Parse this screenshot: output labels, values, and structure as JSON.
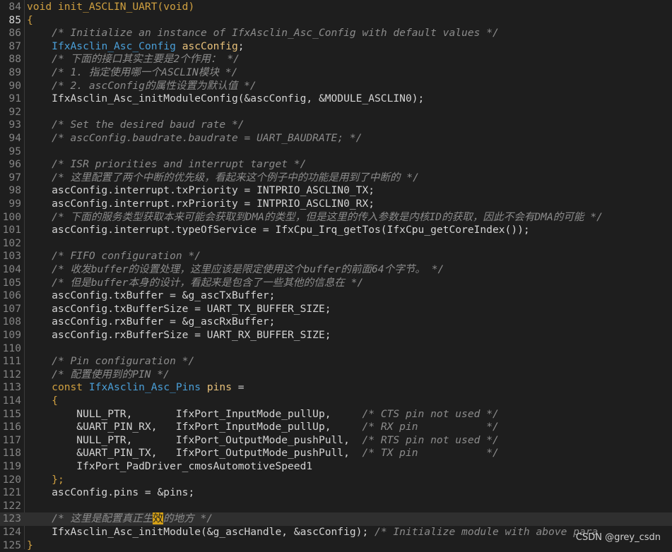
{
  "editor": {
    "lines": [
      {
        "n": "84",
        "segments": [
          {
            "t": "void init_ASCLIN_UART(void)",
            "c": "kw"
          }
        ]
      },
      {
        "n": "85",
        "current": true,
        "segments": [
          {
            "t": "{",
            "c": "kw"
          }
        ]
      },
      {
        "n": "86",
        "segments": [
          {
            "t": "    "
          },
          {
            "t": "/* Initialize an instance of IfxAsclin_Asc_Config with default values */",
            "c": "cm"
          }
        ]
      },
      {
        "n": "87",
        "segments": [
          {
            "t": "    "
          },
          {
            "t": "IfxAsclin_Asc_Config",
            "c": "ty"
          },
          {
            "t": " "
          },
          {
            "t": "ascConfig",
            "c": "vr"
          },
          {
            "t": ";"
          }
        ]
      },
      {
        "n": "88",
        "segments": [
          {
            "t": "    "
          },
          {
            "t": "/* 下面的接口其实主要是2个作用： */",
            "c": "cm"
          }
        ]
      },
      {
        "n": "89",
        "segments": [
          {
            "t": "    "
          },
          {
            "t": "/* 1. 指定使用哪一个ASCLIN模块 */",
            "c": "cm"
          }
        ]
      },
      {
        "n": "90",
        "segments": [
          {
            "t": "    "
          },
          {
            "t": "/* 2. ascConfig的属性设置为默认值 */",
            "c": "cm"
          }
        ]
      },
      {
        "n": "91",
        "segments": [
          {
            "t": "    IfxAsclin_Asc_initModuleConfig(&ascConfig, &MODULE_ASCLIN0);"
          }
        ]
      },
      {
        "n": "92",
        "segments": []
      },
      {
        "n": "93",
        "segments": [
          {
            "t": "    "
          },
          {
            "t": "/* Set the desired baud rate */",
            "c": "cm"
          }
        ]
      },
      {
        "n": "94",
        "segments": [
          {
            "t": "    "
          },
          {
            "t": "/* ascConfig.baudrate.baudrate = UART_BAUDRATE; */",
            "c": "cm"
          }
        ]
      },
      {
        "n": "95",
        "segments": []
      },
      {
        "n": "96",
        "segments": [
          {
            "t": "    "
          },
          {
            "t": "/* ISR priorities and interrupt target */",
            "c": "cm"
          }
        ]
      },
      {
        "n": "97",
        "segments": [
          {
            "t": "    "
          },
          {
            "t": "/* 这里配置了两个中断的优先级，看起来这个例子中的功能是用到了中断的 */",
            "c": "cm"
          }
        ]
      },
      {
        "n": "98",
        "segments": [
          {
            "t": "    ascConfig.interrupt.txPriority = INTPRIO_ASCLIN0_TX;"
          }
        ]
      },
      {
        "n": "99",
        "segments": [
          {
            "t": "    ascConfig.interrupt.rxPriority = INTPRIO_ASCLIN0_RX;"
          }
        ]
      },
      {
        "n": "100",
        "segments": [
          {
            "t": "    "
          },
          {
            "t": "/* 下面的服务类型获取本来可能会获取到DMA的类型，但是这里的传入参数是内核ID的获取，因此不会有DMA的可能 */",
            "c": "cm"
          }
        ]
      },
      {
        "n": "101",
        "segments": [
          {
            "t": "    ascConfig.interrupt.typeOfService = IfxCpu_Irq_getTos(IfxCpu_getCoreIndex());"
          }
        ]
      },
      {
        "n": "102",
        "segments": []
      },
      {
        "n": "103",
        "segments": [
          {
            "t": "    "
          },
          {
            "t": "/* FIFO configuration */",
            "c": "cm"
          }
        ]
      },
      {
        "n": "104",
        "segments": [
          {
            "t": "    "
          },
          {
            "t": "/* 收发buffer的设置处理，这里应该是限定使用这个buffer的前面64个字节。 */",
            "c": "cm"
          }
        ]
      },
      {
        "n": "105",
        "segments": [
          {
            "t": "    "
          },
          {
            "t": "/* 但是buffer本身的设计，看起来是包含了一些其他的信息在 */",
            "c": "cm"
          }
        ]
      },
      {
        "n": "106",
        "segments": [
          {
            "t": "    ascConfig.txBuffer = &g_ascTxBuffer;"
          }
        ]
      },
      {
        "n": "107",
        "segments": [
          {
            "t": "    ascConfig.txBufferSize = UART_TX_BUFFER_SIZE;"
          }
        ]
      },
      {
        "n": "108",
        "segments": [
          {
            "t": "    ascConfig.rxBuffer = &g_ascRxBuffer;"
          }
        ]
      },
      {
        "n": "109",
        "segments": [
          {
            "t": "    ascConfig.rxBufferSize = UART_RX_BUFFER_SIZE;"
          }
        ]
      },
      {
        "n": "110",
        "segments": []
      },
      {
        "n": "111",
        "segments": [
          {
            "t": "    "
          },
          {
            "t": "/* Pin configuration */",
            "c": "cm"
          }
        ]
      },
      {
        "n": "112",
        "segments": [
          {
            "t": "    "
          },
          {
            "t": "/* 配置使用到的PIN */",
            "c": "cm"
          }
        ]
      },
      {
        "n": "113",
        "segments": [
          {
            "t": "    "
          },
          {
            "t": "const",
            "c": "kw"
          },
          {
            "t": " "
          },
          {
            "t": "IfxAsclin_Asc_Pins",
            "c": "ty"
          },
          {
            "t": " "
          },
          {
            "t": "pins",
            "c": "vr"
          },
          {
            "t": " ="
          }
        ]
      },
      {
        "n": "114",
        "segments": [
          {
            "t": "    "
          },
          {
            "t": "{",
            "c": "kw"
          }
        ]
      },
      {
        "n": "115",
        "segments": [
          {
            "t": "        NULL_PTR,       IfxPort_InputMode_pullUp,     "
          },
          {
            "t": "/* CTS pin not used */",
            "c": "cm"
          }
        ]
      },
      {
        "n": "116",
        "segments": [
          {
            "t": "        &UART_PIN_RX,   IfxPort_InputMode_pullUp,     "
          },
          {
            "t": "/* RX pin           */",
            "c": "cm"
          }
        ]
      },
      {
        "n": "117",
        "segments": [
          {
            "t": "        NULL_PTR,       IfxPort_OutputMode_pushPull,  "
          },
          {
            "t": "/* RTS pin not used */",
            "c": "cm"
          }
        ]
      },
      {
        "n": "118",
        "segments": [
          {
            "t": "        &UART_PIN_TX,   IfxPort_OutputMode_pushPull,  "
          },
          {
            "t": "/* TX pin           */",
            "c": "cm"
          }
        ]
      },
      {
        "n": "119",
        "segments": [
          {
            "t": "        IfxPort_PadDriver_cmosAutomotiveSpeed1"
          }
        ]
      },
      {
        "n": "120",
        "segments": [
          {
            "t": "    "
          },
          {
            "t": "};",
            "c": "kw"
          }
        ]
      },
      {
        "n": "121",
        "segments": [
          {
            "t": "    ascConfig.pins = &pins;"
          }
        ]
      },
      {
        "n": "122",
        "segments": []
      },
      {
        "n": "123",
        "highlight": true,
        "segments": [
          {
            "t": "    "
          },
          {
            "t": "/* 这里是配置真正生",
            "c": "cm"
          },
          {
            "t": "效",
            "c": "hlchar"
          },
          {
            "t": "的地方 */",
            "c": "cm"
          }
        ]
      },
      {
        "n": "124",
        "segments": [
          {
            "t": "    IfxAsclin_Asc_initModule(&g_ascHandle, &ascConfig); "
          },
          {
            "t": "/* Initialize module with above para",
            "c": "cm"
          }
        ]
      },
      {
        "n": "125",
        "segments": [
          {
            "t": "}",
            "c": "kw"
          }
        ]
      }
    ]
  },
  "watermark": "CSDN @grey_csdn"
}
